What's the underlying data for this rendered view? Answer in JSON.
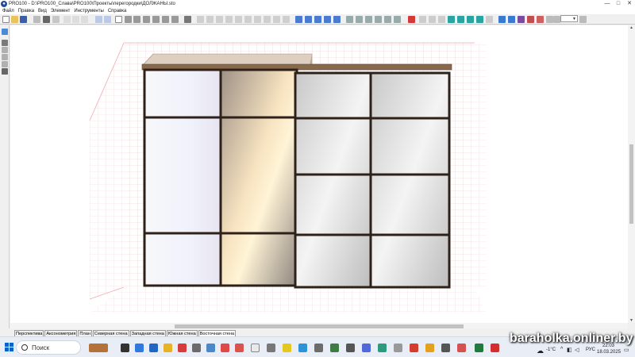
{
  "window": {
    "title": "PRO100 - D:\\PRO100_Слава\\PRO100\\Проекты\\перегородки\\ДОЛЖАНЫ.sto",
    "app_icon": "pro100-logo-icon",
    "controls": [
      "—",
      "□",
      "✕"
    ]
  },
  "menu": [
    "Файл",
    "Правка",
    "Вид",
    "Элемент",
    "Инструменты",
    "Справка"
  ],
  "toolbar": {
    "zoom_value": ""
  },
  "tabs": [
    {
      "label": "Перспектива",
      "active": false
    },
    {
      "label": "Аксонометрия",
      "active": false
    },
    {
      "label": "План",
      "active": false
    },
    {
      "label": "Северная стена",
      "active": false
    },
    {
      "label": "Западная стена",
      "active": false
    },
    {
      "label": "Южная стена",
      "active": false
    },
    {
      "label": "Восточная стена",
      "active": true
    }
  ],
  "taskbar": {
    "search_placeholder": "Поиск",
    "weather": "-1°C",
    "language": "РУС",
    "time": "22:03",
    "date": "18.03.2025"
  },
  "watermark": "baraholka.onliner.by",
  "colors": {
    "frame": "#2e211a",
    "top_board": "#8a6a4c",
    "grid": "#f3b3b8",
    "accent": "#0a64c8"
  }
}
